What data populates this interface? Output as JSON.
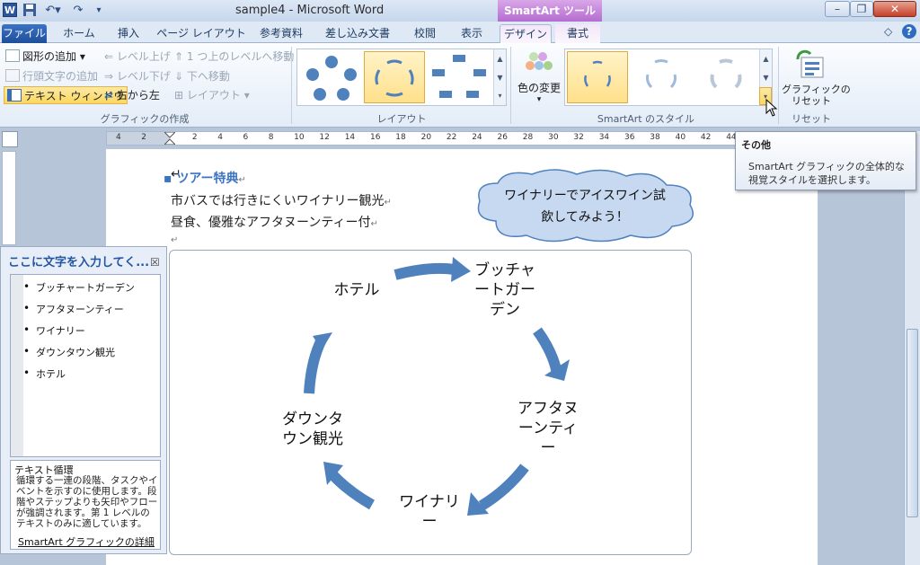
{
  "window": {
    "title": "sample4 - Microsoft Word",
    "app_icon": "W",
    "contextual_tab_group": "SmartArt ツール"
  },
  "quick_access": {
    "save": "save-icon",
    "undo": "undo-icon",
    "redo": "redo-icon",
    "customize": "dropdown-icon"
  },
  "tabs": [
    {
      "label": "ファイル"
    },
    {
      "label": "ホーム"
    },
    {
      "label": "挿入"
    },
    {
      "label": "ページ レイアウト"
    },
    {
      "label": "参考資料"
    },
    {
      "label": "差し込み文書"
    },
    {
      "label": "校閲"
    },
    {
      "label": "表示"
    },
    {
      "label": "デザイン"
    },
    {
      "label": "書式"
    }
  ],
  "ribbon": {
    "create_graphic": {
      "label": "グラフィックの作成",
      "add_shape": "図形の追加",
      "add_bullet": "行頭文字の追加",
      "text_pane": "テキスト ウィンドウ",
      "promote": "レベル上げ",
      "demote": "レベル下げ",
      "right_to_left": "右から左",
      "move_up": "1 つ上のレベルへ移動",
      "move_down": "下へ移動",
      "layout": "レイアウト"
    },
    "layouts": {
      "label": "レイアウト"
    },
    "styles": {
      "label": "SmartArt のスタイル",
      "change_colors": "色の変更"
    },
    "reset": {
      "label": "リセット",
      "reset_graphic": "グラフィックの\nリセット"
    }
  },
  "ruler": {
    "numbers": [
      "4",
      "2",
      "",
      "2",
      "4",
      "6",
      "8",
      "10",
      "12",
      "14",
      "16",
      "18",
      "20",
      "22",
      "24",
      "26",
      "28",
      "30",
      "32",
      "34",
      "36",
      "38",
      "40",
      "42",
      "44"
    ]
  },
  "document": {
    "heading": "ツアー特典",
    "line1": "市バスでは行きにくいワイナリー観光",
    "line2": "昼食、優雅なアフタヌーンティー付",
    "callout": "ワイナリーでアイスワイン試飲してみよう！"
  },
  "smartart": {
    "nodes": [
      "ホテル",
      "ブッチャートガーデン",
      "アフタヌーンティー",
      "ワイナリー",
      "ダウンタウン観光"
    ],
    "node_display": {
      "hotel": "ホテル",
      "butchart": [
        "ブッチャ",
        "ートガー",
        "デン"
      ],
      "afternoon": [
        "アフタヌ",
        "ーンティ",
        "ー"
      ],
      "winery": [
        "ワイナリ",
        "ー"
      ],
      "downtown": [
        "ダウンタ",
        "ウン観光"
      ]
    },
    "arrow_color": "#4f81bd"
  },
  "text_pane": {
    "title": "ここに文字を入力してく...",
    "close": "☒",
    "items": [
      "ブッチャートガーデン",
      "アフタヌーンティー",
      "ワイナリー",
      "ダウンタウン観光",
      "ホテル"
    ],
    "desc_title": "テキスト循環",
    "desc_body": "循環する一連の段階、タスクやイベントを示すのに使用します。段階やステップよりも矢印やフローが強調されます。第 1 レベルのテキストのみに適しています。",
    "link": "SmartArt グラフィックの詳細"
  },
  "tooltip": {
    "title": "その他",
    "body": "SmartArt グラフィックの全体的な視覚スタイルを選択します。"
  },
  "colors": {
    "accent": "#4f81bd",
    "heading": "#3c74c3",
    "contextual": "#b56cd0"
  }
}
